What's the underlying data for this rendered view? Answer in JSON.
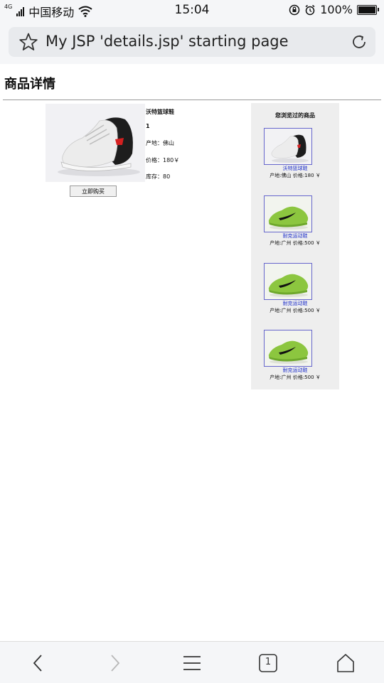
{
  "status_bar": {
    "network": "4G",
    "carrier": "中国移动",
    "time": "15:04",
    "battery": "100%"
  },
  "browser": {
    "page_title": "My JSP 'details.jsp' starting page",
    "tab_count": "1"
  },
  "page": {
    "heading": "商品详情",
    "product": {
      "name": "沃特篮球鞋",
      "number": "1",
      "origin": "产地：佛山",
      "price": "价格：180￥",
      "stock": "库存：80",
      "buy_label": "立即购买"
    },
    "history": {
      "heading": "您浏览过的商品",
      "items": [
        {
          "name": "沃特篮球鞋",
          "meta": "产地:佛山  价格:180 ￥",
          "image": "white-basketball-shoe"
        },
        {
          "name": "耐克运动鞋",
          "meta": "产地:广州  价格:500 ￥",
          "image": "green-nike-shoe"
        },
        {
          "name": "耐克运动鞋",
          "meta": "产地:广州  价格:500 ￥",
          "image": "green-nike-shoe"
        },
        {
          "name": "耐克运动鞋",
          "meta": "产地:广州  价格:500 ￥",
          "image": "green-nike-shoe"
        }
      ]
    }
  },
  "icons": {
    "star": "star-icon",
    "reload": "reload-icon",
    "back": "back-icon",
    "forward": "forward-icon",
    "menu": "menu-icon",
    "tabs": "tabs-icon",
    "home": "home-icon"
  }
}
